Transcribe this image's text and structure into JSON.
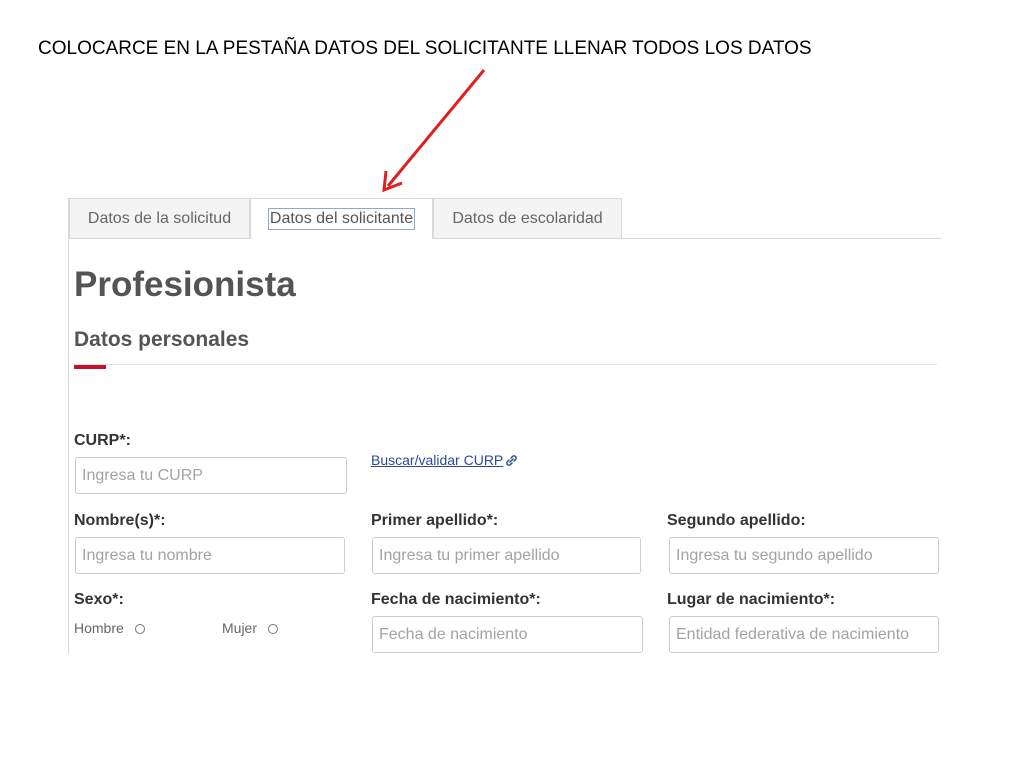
{
  "instruction": "COLOCARCE EN LA PESTAÑA DATOS DEL SOLICITANTE LLENAR TODOS LOS DATOS",
  "tabs": [
    {
      "label": "Datos de la solicitud",
      "active": false
    },
    {
      "label": "Datos del solicitante",
      "active": true
    },
    {
      "label": "Datos de escolaridad",
      "active": false
    }
  ],
  "page_title": "Profesionista",
  "section_title": "Datos personales",
  "accent_color": "#c8102e",
  "arrow_color": "#e02020",
  "curp": {
    "label": "CURP*:",
    "placeholder": "Ingresa tu CURP",
    "value": ""
  },
  "curp_link": {
    "label": "Buscar/validar CURP",
    "icon": "link-icon"
  },
  "nombre": {
    "label": "Nombre(s)*:",
    "placeholder": "Ingresa tu nombre",
    "value": ""
  },
  "primer_apellido": {
    "label": "Primer apellido*:",
    "placeholder": "Ingresa tu primer apellido",
    "value": ""
  },
  "segundo_apellido": {
    "label": "Segundo apellido:",
    "placeholder": "Ingresa tu segundo apellido",
    "value": ""
  },
  "sexo": {
    "label": "Sexo*:",
    "options": [
      {
        "label": "Hombre",
        "checked": false
      },
      {
        "label": "Mujer",
        "checked": false
      }
    ]
  },
  "fecha_nacimiento": {
    "label": "Fecha de nacimiento*:",
    "placeholder": "Fecha de nacimiento",
    "value": ""
  },
  "lugar_nacimiento": {
    "label": "Lugar de nacimiento*:",
    "placeholder": "Entidad federativa de nacimiento",
    "value": ""
  }
}
